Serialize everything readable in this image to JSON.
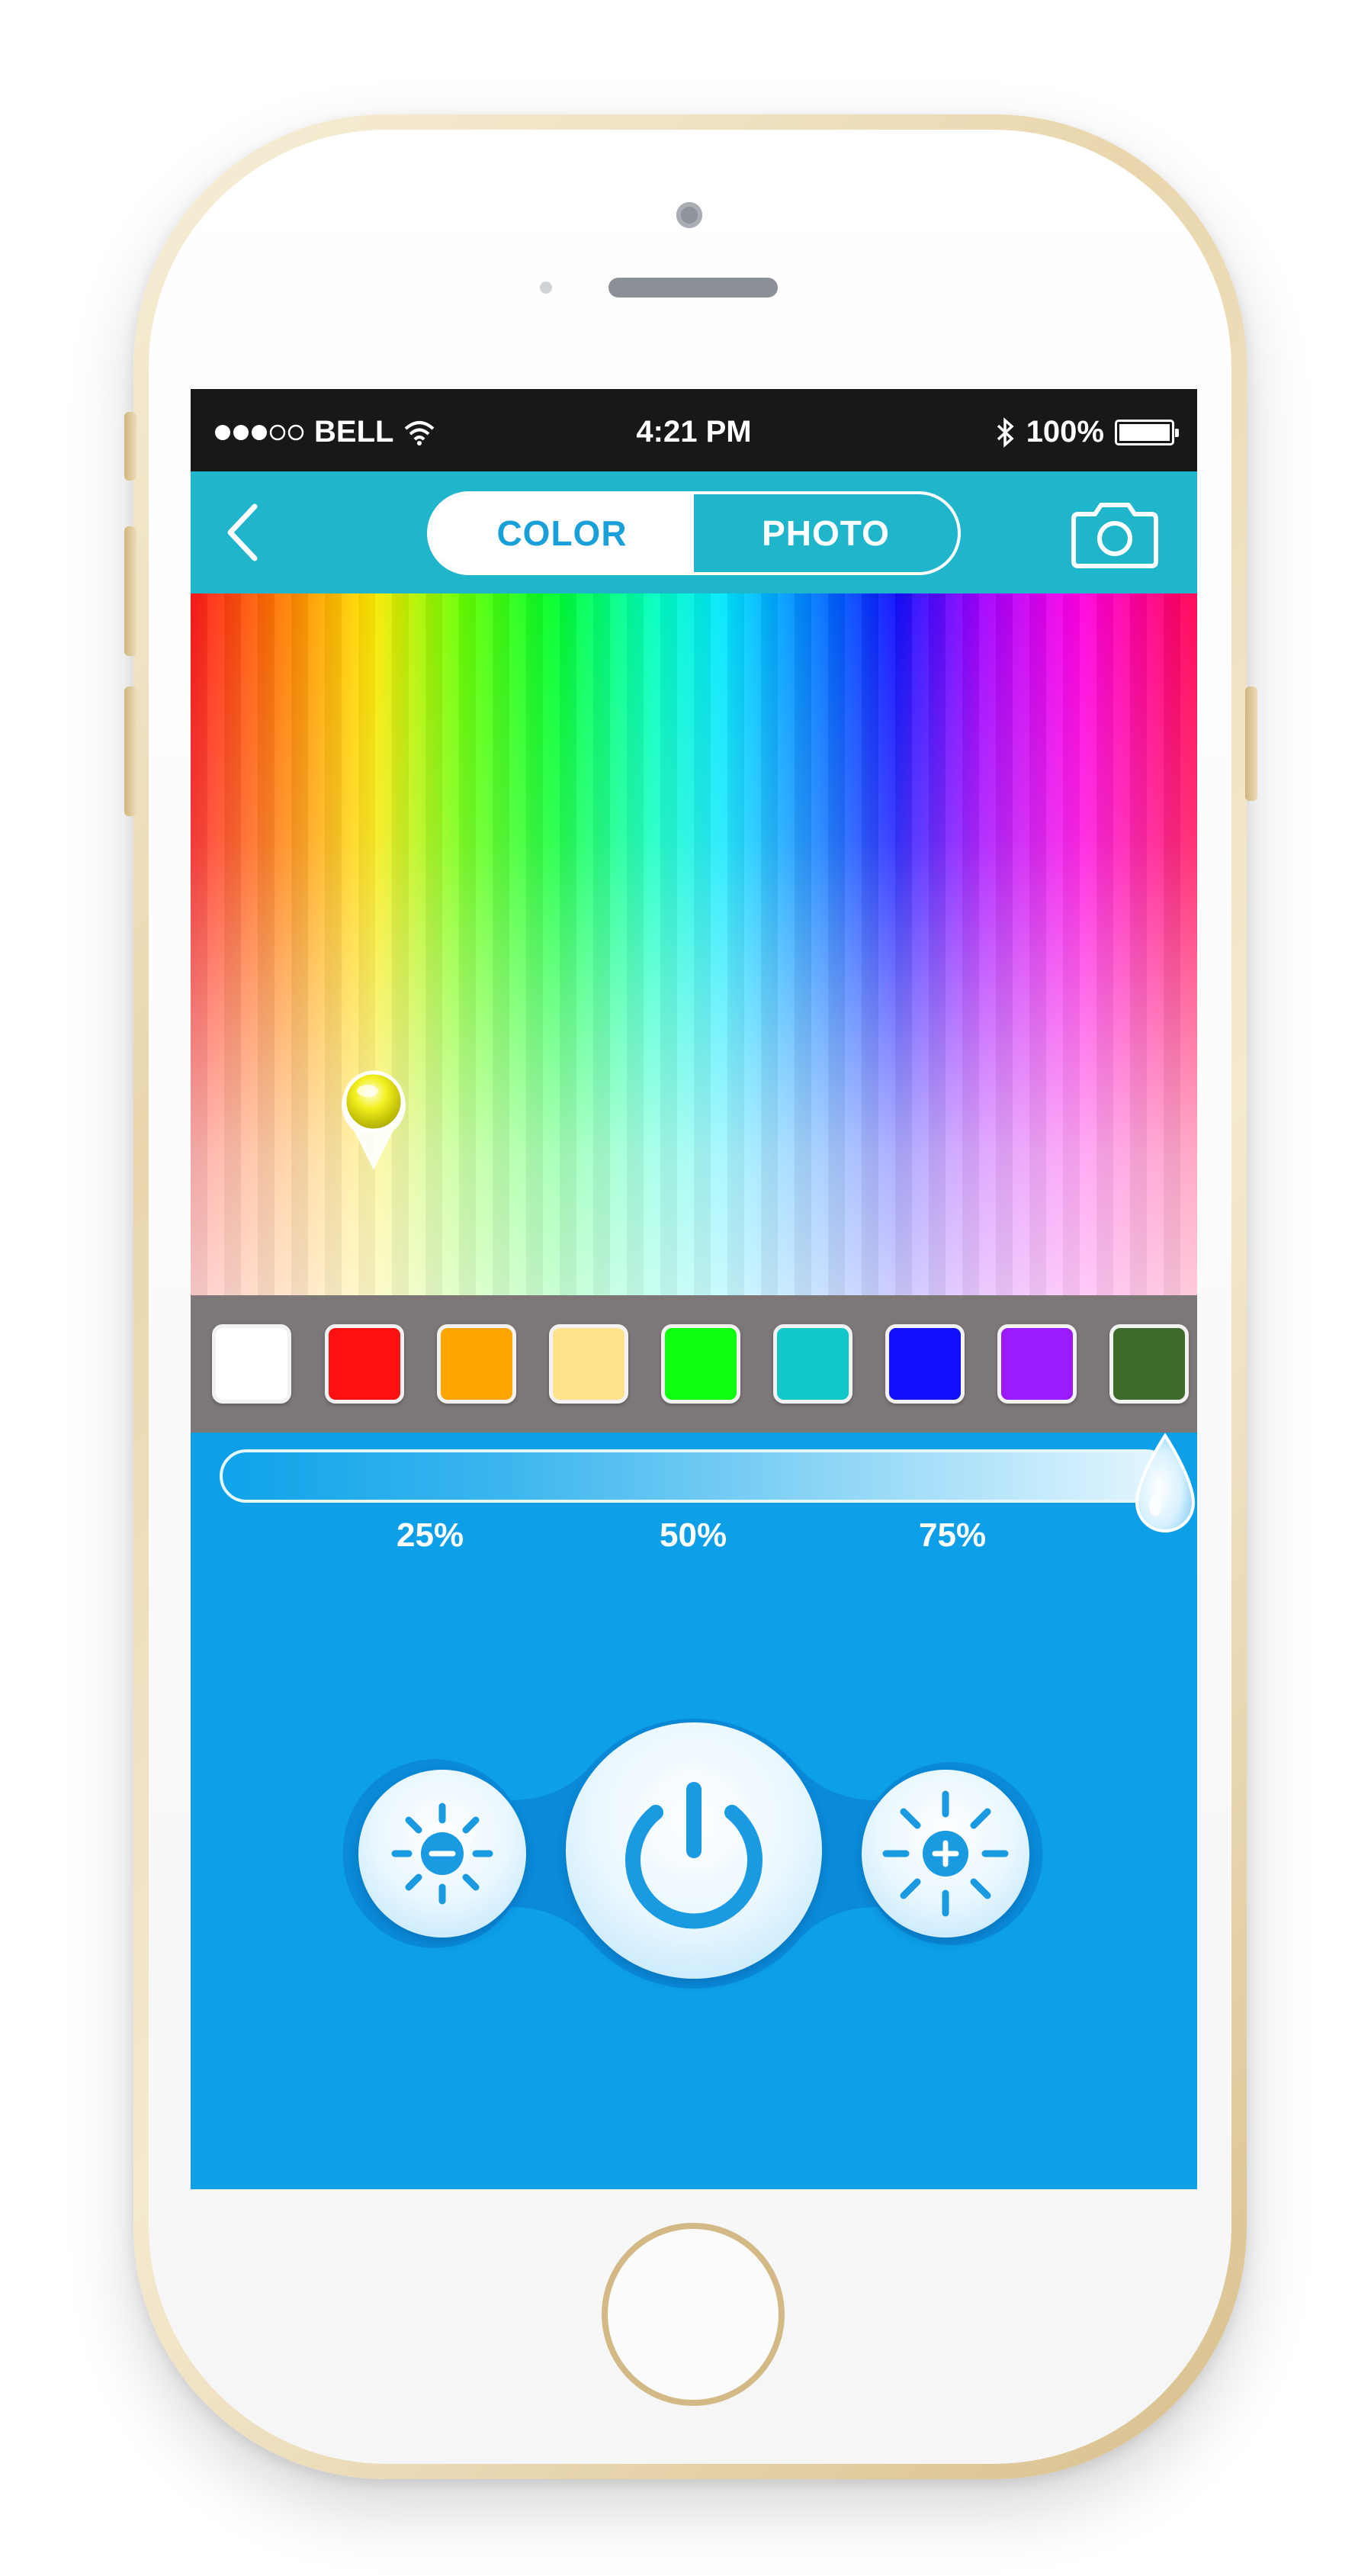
{
  "status_bar": {
    "carrier": "BELL",
    "time": "4:21 PM",
    "battery": "100%",
    "signal_icon": "signal-dots-icon",
    "wifi_icon": "wifi-icon",
    "bluetooth_icon": "bluetooth-icon"
  },
  "navbar": {
    "back_icon": "chevron-left-icon",
    "tabs": [
      {
        "label": "COLOR",
        "active": true
      },
      {
        "label": "PHOTO",
        "active": false
      }
    ],
    "camera_icon": "camera-icon"
  },
  "swatches": [
    {
      "name": "white",
      "color": "#ffffff"
    },
    {
      "name": "red",
      "color": "#ff1010"
    },
    {
      "name": "orange",
      "color": "#ffa500"
    },
    {
      "name": "light-yellow",
      "color": "#ffe28a"
    },
    {
      "name": "green",
      "color": "#10ff10"
    },
    {
      "name": "teal",
      "color": "#12c8c8"
    },
    {
      "name": "blue",
      "color": "#1010ff"
    },
    {
      "name": "purple",
      "color": "#9b1bff"
    },
    {
      "name": "dark-green",
      "color": "#3f6b2a"
    }
  ],
  "brightness": {
    "ticks": [
      "25%",
      "50%",
      "75%"
    ],
    "value_fraction": 1.0
  },
  "controls": {
    "dim_icon": "sun-minus-icon",
    "power_icon": "power-icon",
    "brighten_icon": "sun-plus-icon"
  },
  "colors": {
    "screen_bg": "#0d9fe8",
    "navbar_bg": "#1fb6cc",
    "accent": "#1aa0d8"
  }
}
